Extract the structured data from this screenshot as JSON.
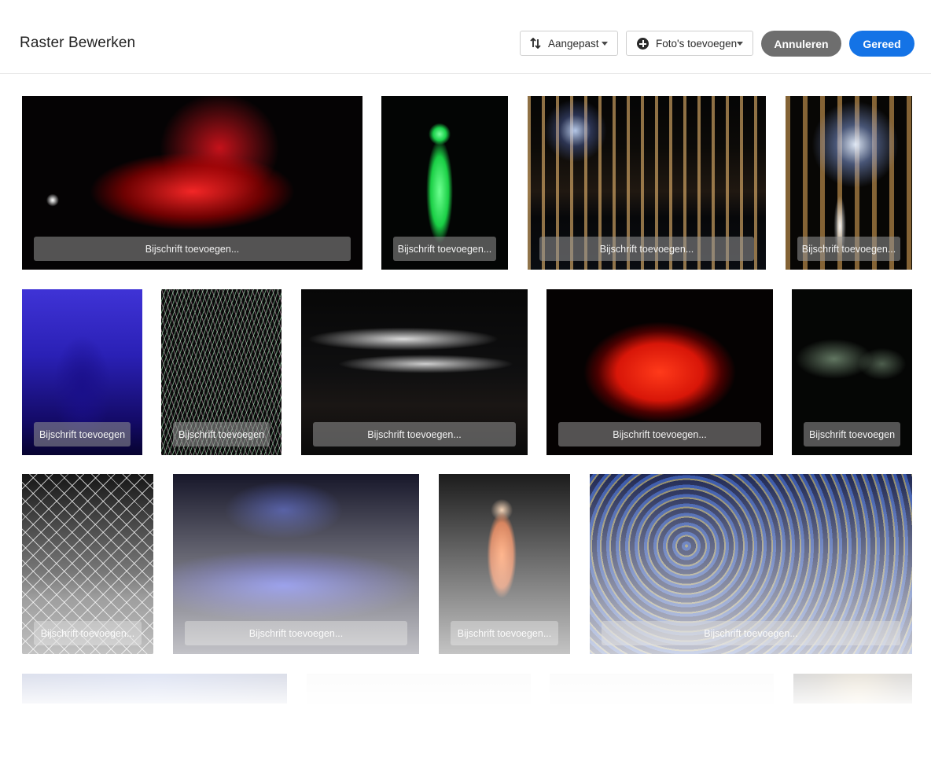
{
  "header": {
    "title": "Raster Bewerken",
    "sort_label": "Aangepast",
    "add_photos_label": "Foto's toevoegen",
    "cancel_label": "Annuleren",
    "done_label": "Gereed"
  },
  "colors": {
    "accent": "#1473e6",
    "cancel": "#6e6e6e"
  },
  "grid": {
    "rows": [
      {
        "tiles": [
          {
            "caption": "Bijschrift toevoegen...",
            "scene": "red-tentacle-sculpture"
          },
          {
            "caption": "Bijschrift toevoegen...",
            "scene": "green-pedestrian-light"
          },
          {
            "caption": "Bijschrift toevoegen...",
            "scene": "canal-houses-dandelion"
          },
          {
            "caption": "Bijschrift toevoegen...",
            "scene": "dandelion-lamp-closeup"
          }
        ]
      },
      {
        "tiles": [
          {
            "caption": "Bijschrift toevoegen",
            "scene": "blue-gothic-arch"
          },
          {
            "caption": "Bijschrift toevoegen",
            "scene": "rainbow-string-lines"
          },
          {
            "caption": "Bijschrift toevoegen...",
            "scene": "white-light-ribbons"
          },
          {
            "caption": "Bijschrift toevoegen...",
            "scene": "red-light-cloud"
          },
          {
            "caption": "Bijschrift toevoegen",
            "scene": "dark-building-windows"
          }
        ]
      },
      {
        "tiles": [
          {
            "caption": "Bijschrift toevoegen...",
            "scene": "fireworks-lattice"
          },
          {
            "caption": "Bijschrift toevoegen...",
            "scene": "blue-tree-road"
          },
          {
            "caption": "Bijschrift toevoegen...",
            "scene": "woman-with-bike"
          },
          {
            "caption": "Bijschrift toevoegen...",
            "scene": "starry-night-lights"
          }
        ]
      },
      {
        "tiles": [
          {
            "caption": "",
            "scene": "partial-blue"
          },
          {
            "caption": "",
            "scene": "partial-light"
          },
          {
            "caption": "",
            "scene": "partial-light"
          },
          {
            "caption": "",
            "scene": "partial-warm"
          }
        ]
      }
    ]
  }
}
